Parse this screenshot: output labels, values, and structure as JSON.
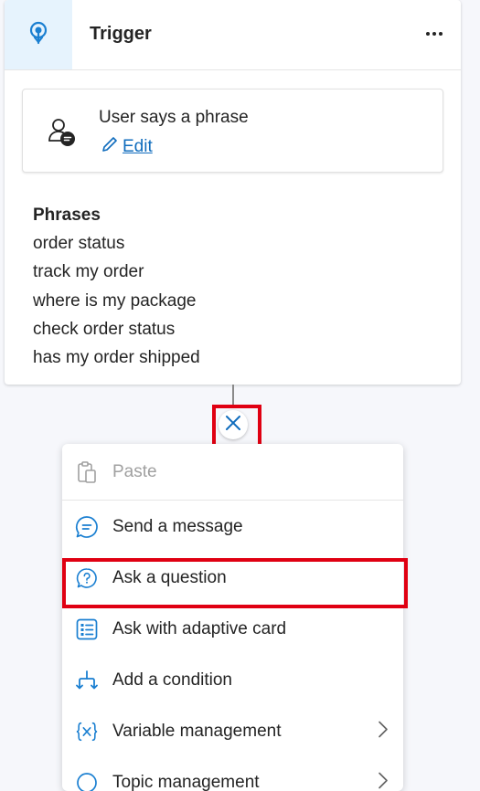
{
  "trigger": {
    "title": "Trigger",
    "icon": "trigger-bulb-icon",
    "more_icon": "more-horizontal-icon"
  },
  "phrase_box": {
    "title": "User says a phrase",
    "edit_label": "Edit",
    "icon": "user-chat-icon"
  },
  "phrases": {
    "label": "Phrases",
    "items": [
      "order status",
      "track my order",
      "where is my package",
      "check order status",
      "has my order shipped"
    ]
  },
  "menu": {
    "close_icon": "close-icon",
    "items": [
      {
        "label": "Paste",
        "icon": "clipboard-icon",
        "disabled": true
      },
      {
        "label": "Send a message",
        "icon": "chat-bubble-icon"
      },
      {
        "label": "Ask a question",
        "icon": "question-bubble-icon"
      },
      {
        "label": "Ask with adaptive card",
        "icon": "adaptive-card-icon"
      },
      {
        "label": "Add a condition",
        "icon": "branch-icon"
      },
      {
        "label": "Variable management",
        "icon": "variable-icon",
        "submenu": true
      },
      {
        "label": "Topic management",
        "icon": "topic-icon",
        "submenu": true
      }
    ]
  },
  "colors": {
    "accent": "#0f6cbd",
    "highlight": "#e00012",
    "icon_blue": "#1a7fd1"
  }
}
